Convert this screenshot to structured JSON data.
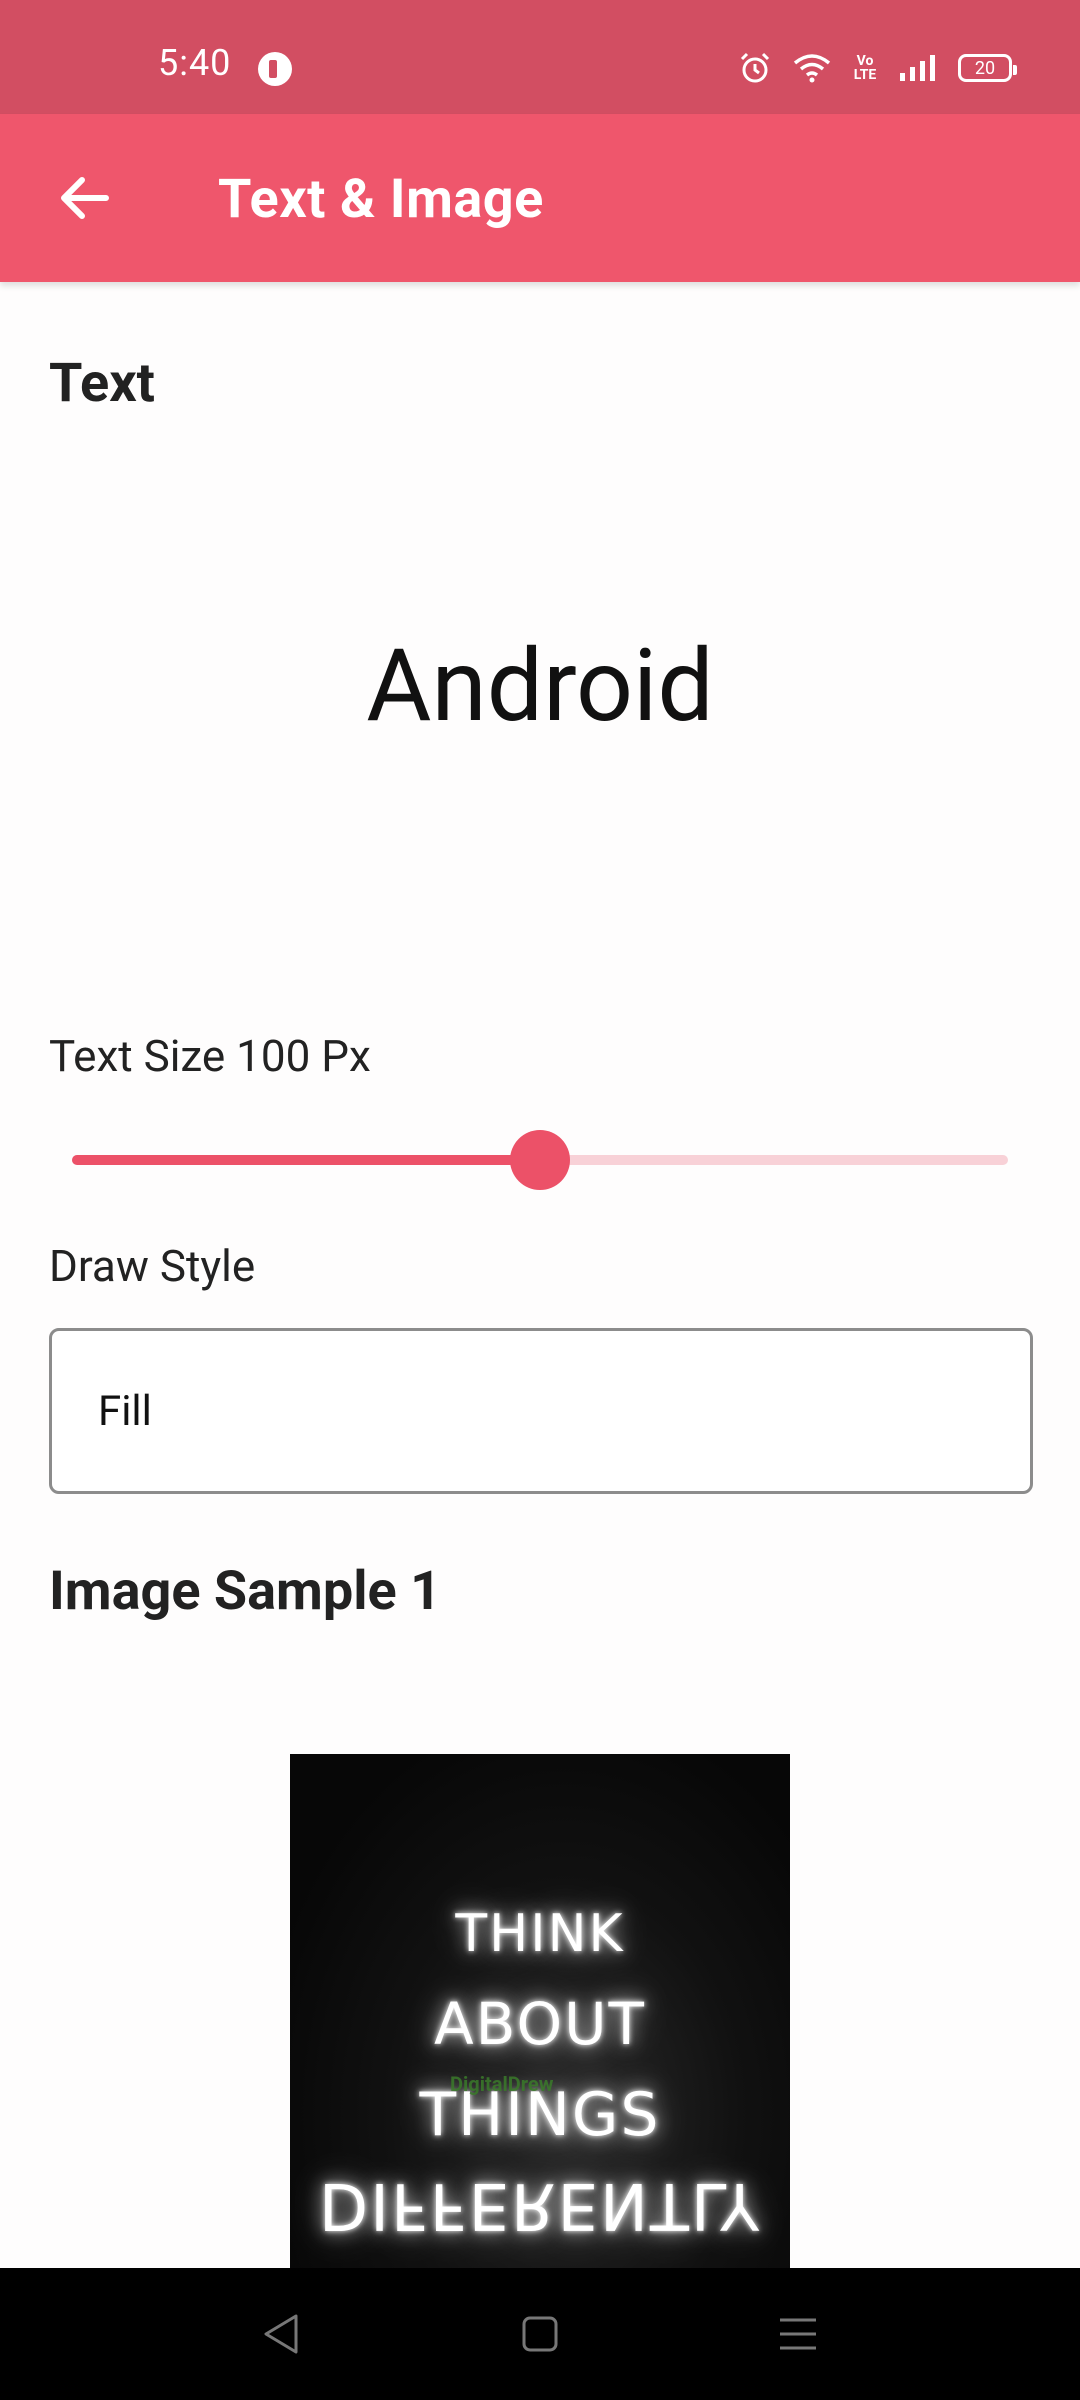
{
  "status_bar": {
    "time": "5:40",
    "battery": "20",
    "volte": "Vo LTE",
    "icons": [
      "app-notification-icon",
      "alarm-icon",
      "wifi-icon",
      "volte-icon",
      "signal-icon",
      "battery-icon"
    ]
  },
  "app_bar": {
    "title": "Text & Image",
    "back_icon": "arrow-left-icon"
  },
  "text_section": {
    "title": "Text",
    "preview": "Android"
  },
  "text_size": {
    "label": "Text Size 100 Px",
    "slider_fraction": 0.5
  },
  "draw_style": {
    "label": "Draw Style",
    "value": "Fill"
  },
  "image_section": {
    "title": "Image Sample 1",
    "lines": [
      "THINK",
      "ABOUT",
      "THINGS",
      "DIFFERENTLY"
    ],
    "watermark": "DigitalDrew"
  },
  "colors": {
    "status_bar": "#d24e62",
    "app_bar": "#ef566c",
    "accent": "#ec5168",
    "track_inactive": "#f8d1d7"
  },
  "nav_bar": {
    "icons": [
      "back-triangle-icon",
      "home-square-icon",
      "menu-lines-icon"
    ]
  }
}
